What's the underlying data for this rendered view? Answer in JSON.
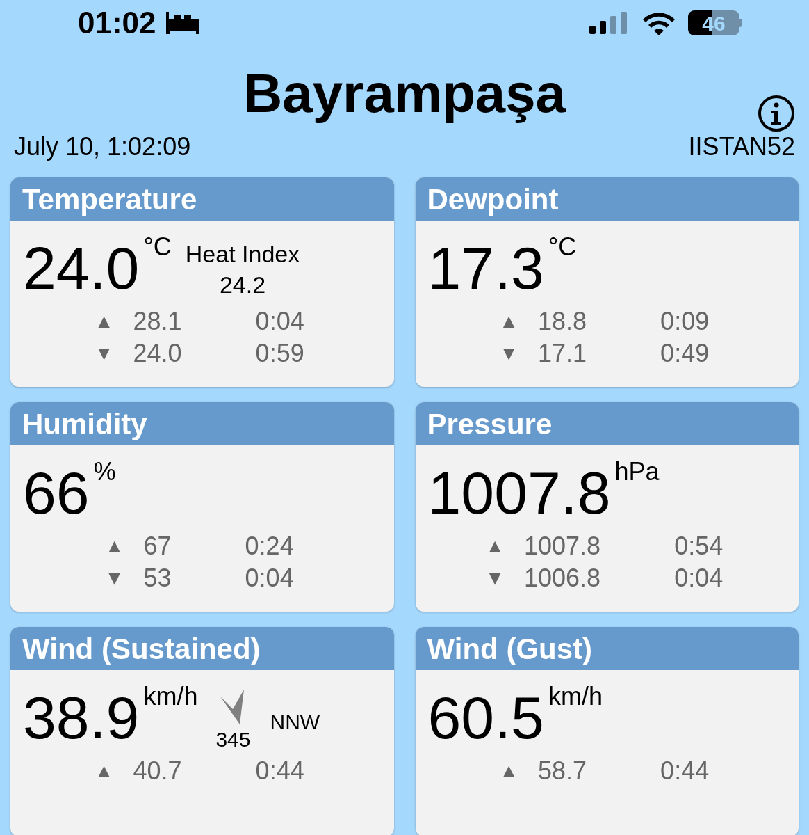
{
  "status_bar": {
    "time": "01:02",
    "battery": "46"
  },
  "header": {
    "title": "Bayrampaşa",
    "datetime": "July 10, 1:02:09",
    "station": "IISTAN52"
  },
  "cards": [
    {
      "title": "Temperature",
      "value": "24.0",
      "unit": "°C",
      "extra": {
        "kind": "heat_index",
        "label": "Heat Index",
        "value": "24.2"
      },
      "stats": [
        {
          "arrow": "▲",
          "value": "28.1",
          "time": "0:04"
        },
        {
          "arrow": "▼",
          "value": "24.0",
          "time": "0:59"
        }
      ]
    },
    {
      "title": "Dewpoint",
      "value": "17.3",
      "unit": "°C",
      "stats": [
        {
          "arrow": "▲",
          "value": "18.8",
          "time": "0:09"
        },
        {
          "arrow": "▼",
          "value": "17.1",
          "time": "0:49"
        }
      ]
    },
    {
      "title": "Humidity",
      "value": "66",
      "unit": "%",
      "stats": [
        {
          "arrow": "▲",
          "value": "67",
          "time": "0:24"
        },
        {
          "arrow": "▼",
          "value": "53",
          "time": "0:04"
        }
      ]
    },
    {
      "title": "Pressure",
      "value": "1007.8",
      "unit": "hPa",
      "stats": [
        {
          "arrow": "▲",
          "value": "1007.8",
          "time": "0:54"
        },
        {
          "arrow": "▼",
          "value": "1006.8",
          "time": "0:04"
        }
      ]
    },
    {
      "title": "Wind (Sustained)",
      "value": "38.9",
      "unit": "km/h",
      "extra": {
        "kind": "direction",
        "degrees": "345",
        "compass": "NNW"
      },
      "stats": [
        {
          "arrow": "▲",
          "value": "40.7",
          "time": "0:44"
        }
      ]
    },
    {
      "title": "Wind (Gust)",
      "value": "60.5",
      "unit": "km/h",
      "stats": [
        {
          "arrow": "▲",
          "value": "58.7",
          "time": "0:44"
        }
      ]
    }
  ]
}
